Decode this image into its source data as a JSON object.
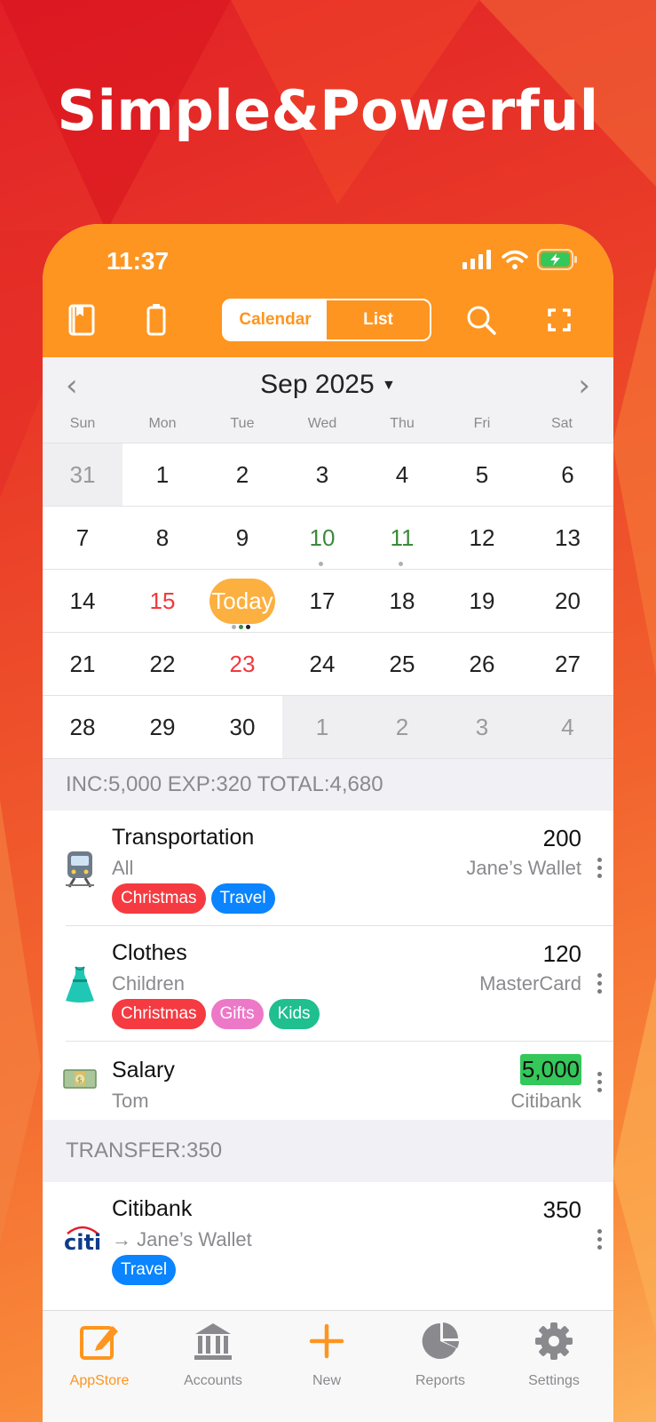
{
  "headline": "Simple&Powerful",
  "status": {
    "time": "11:37"
  },
  "toolbar": {
    "segments": [
      "Calendar",
      "List"
    ],
    "active_segment": "Calendar"
  },
  "calendar": {
    "month_label": "Sep 2025",
    "weekdays": [
      "Sun",
      "Mon",
      "Tue",
      "Wed",
      "Thu",
      "Fri",
      "Sat"
    ],
    "weeks": [
      [
        "31",
        "1",
        "2",
        "3",
        "4",
        "5",
        "6"
      ],
      [
        "7",
        "8",
        "9",
        "10",
        "11",
        "12",
        "13"
      ],
      [
        "14",
        "15",
        "Today",
        "17",
        "18",
        "19",
        "20"
      ],
      [
        "21",
        "22",
        "23",
        "24",
        "25",
        "26",
        "27"
      ],
      [
        "28",
        "29",
        "30",
        "1",
        "2",
        "3",
        "4"
      ]
    ]
  },
  "summary": "INC:5,000  EXP:320  TOTAL:4,680",
  "transactions": [
    {
      "title": "Transportation",
      "subtitle": "All",
      "amount": "200",
      "account": "Jane’s Wallet",
      "tags": [
        "Christmas",
        "Travel"
      ],
      "icon": "train-icon"
    },
    {
      "title": "Clothes",
      "subtitle": "Children",
      "amount": "120",
      "account": "MasterCard",
      "tags": [
        "Christmas",
        "Gifts",
        "Kids"
      ],
      "icon": "dress-icon"
    },
    {
      "title": "Salary",
      "subtitle": "Tom",
      "amount": "5,000",
      "account": "Citibank",
      "tags": [],
      "icon": "money-icon"
    }
  ],
  "transfer_header": "TRANSFER:350",
  "transfer": {
    "title": "Citibank",
    "subtitle": "→ Jane’s Wallet",
    "amount": "350",
    "tags": [
      "Travel"
    ],
    "icon": "citi-logo"
  },
  "tabbar": {
    "items": [
      {
        "label": "AppStore",
        "icon": "edit-icon",
        "active": true
      },
      {
        "label": "Accounts",
        "icon": "bank-icon",
        "active": false
      },
      {
        "label": "New",
        "icon": "plus-icon",
        "active": false
      },
      {
        "label": "Reports",
        "icon": "pie-chart-icon",
        "active": false
      },
      {
        "label": "Settings",
        "icon": "gear-icon",
        "active": false
      }
    ]
  },
  "colors": {
    "accent": "#fe9520",
    "income": "#34c759",
    "red": "#f0393f",
    "green": "#3c8a3c",
    "tag_red": "#f53b41",
    "tag_blue": "#0a84ff",
    "tag_pink": "#ee78c8",
    "tag_teal": "#1fbf8f"
  }
}
